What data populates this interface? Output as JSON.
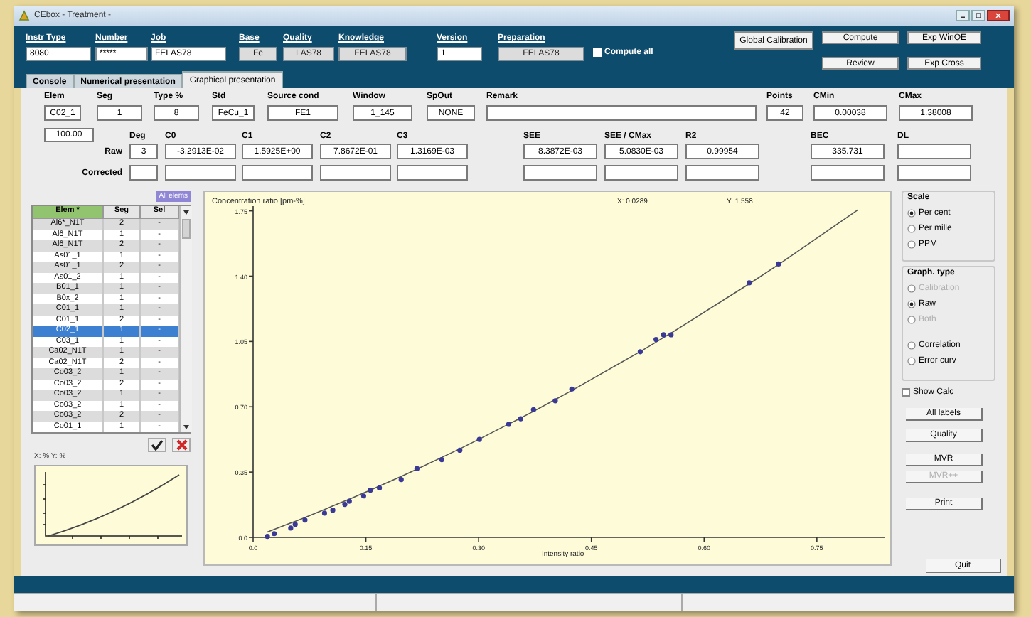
{
  "window": {
    "title": "CEbox - Treatment -"
  },
  "header": {
    "fields": [
      {
        "label": "Instr Type",
        "value": "8080",
        "disabled": false
      },
      {
        "label": "Number",
        "value": "*****",
        "disabled": false
      },
      {
        "label": "Job",
        "value": "FELAS78",
        "disabled": false
      },
      {
        "label": "Base",
        "value": "Fe",
        "disabled": true
      },
      {
        "label": "Quality",
        "value": "LAS78",
        "disabled": true
      },
      {
        "label": "Knowledge",
        "value": "FELAS78",
        "disabled": true
      },
      {
        "label": "Version",
        "value": "1",
        "disabled": false
      },
      {
        "label": "Preparation",
        "value": "FELAS78",
        "disabled": true
      }
    ],
    "compute_all": {
      "label": "Compute all",
      "checked": false
    },
    "buttons": [
      "Global Calibration",
      "Compute",
      "Exp WinOE",
      "Review",
      "Exp Cross"
    ]
  },
  "tabs": [
    {
      "label": "Console",
      "selected": false
    },
    {
      "label": "Numerical presentation",
      "selected": false
    },
    {
      "label": "Graphical presentation",
      "selected": true
    }
  ],
  "element_form": {
    "fields": [
      {
        "label": "Elem",
        "value": "C02_1"
      },
      {
        "label": "Seg",
        "value": "1"
      },
      {
        "label": "Type %",
        "value": "8"
      },
      {
        "label": "Std",
        "value": "FeCu_1"
      },
      {
        "label": "Source cond",
        "value": "FE1"
      },
      {
        "label": "Window",
        "value": "1_145"
      },
      {
        "label": "SpOut",
        "value": "NONE"
      },
      {
        "label": "Remark"
      },
      {
        "label": "Points",
        "value": "42"
      },
      {
        "label": "CMin",
        "value": "0.00038"
      },
      {
        "label": "CMax",
        "value": "1.38008"
      }
    ],
    "field_under_elem": "100.00"
  },
  "calibration": {
    "row_labels": [
      "Raw",
      "Corrected"
    ],
    "columns": [
      {
        "label": "Deg",
        "raw": "3"
      },
      {
        "label": "C0",
        "raw": "-3.2913E-02"
      },
      {
        "label": "C1",
        "raw": "1.5925E+00"
      },
      {
        "label": "C2",
        "raw": "7.8672E-01"
      },
      {
        "label": "C3",
        "raw": "1.3169E-03"
      },
      {
        "label": "SEE",
        "raw": "8.3872E-03"
      },
      {
        "label": "SEE / CMax",
        "raw": "5.0830E-03"
      },
      {
        "label": "R2",
        "raw": "0.99954"
      },
      {
        "label": "BEC",
        "raw": "335.731"
      },
      {
        "label": "DL"
      }
    ]
  },
  "element_list": {
    "all_button": "All elems",
    "columns": [
      "Elem *",
      "Seg",
      "Sel"
    ],
    "rows": [
      {
        "elem": "Al6*_N1T",
        "seg": "2",
        "sel": "-",
        "selected": false
      },
      {
        "elem": "Al6_N1T",
        "seg": "1",
        "sel": "-",
        "selected": false
      },
      {
        "elem": "Al6_N1T",
        "seg": "2",
        "sel": "-",
        "selected": false
      },
      {
        "elem": "As01_1",
        "seg": "1",
        "sel": "-",
        "selected": false
      },
      {
        "elem": "As01_1",
        "seg": "2",
        "sel": "-",
        "selected": false
      },
      {
        "elem": "As01_2",
        "seg": "1",
        "sel": "-",
        "selected": false
      },
      {
        "elem": "B01_1",
        "seg": "1",
        "sel": "-",
        "selected": false
      },
      {
        "elem": "B0x_2",
        "seg": "1",
        "sel": "-",
        "selected": false
      },
      {
        "elem": "C01_1",
        "seg": "1",
        "sel": "-",
        "selected": false
      },
      {
        "elem": "C01_1",
        "seg": "2",
        "sel": "-",
        "selected": false
      },
      {
        "elem": "C02_1",
        "seg": "1",
        "sel": "-",
        "selected": true
      },
      {
        "elem": "C03_1",
        "seg": "1",
        "sel": "-",
        "selected": false
      },
      {
        "elem": "Ca02_N1T",
        "seg": "1",
        "sel": "-",
        "selected": false
      },
      {
        "elem": "Ca02_N1T",
        "seg": "2",
        "sel": "-",
        "selected": false
      },
      {
        "elem": "Co03_2",
        "seg": "1",
        "sel": "-",
        "selected": false
      },
      {
        "elem": "Co03_2",
        "seg": "2",
        "sel": "-",
        "selected": false
      },
      {
        "elem": "Co03_2",
        "seg": "1",
        "sel": "-",
        "selected": false
      },
      {
        "elem": "Co03_2",
        "seg": "1",
        "sel": "-",
        "selected": false
      },
      {
        "elem": "Co03_2",
        "seg": "2",
        "sel": "-",
        "selected": false
      },
      {
        "elem": "Co01_1",
        "seg": "1",
        "sel": "-",
        "selected": false
      }
    ]
  },
  "thumbnail": {
    "caption": "X: % Y: %"
  },
  "chart": {
    "cursor_x": "X: 0.0289",
    "cursor_y": "Y: 1.558",
    "chart_data": {
      "type": "scatter",
      "ylabel": "Concentration ratio [pm-%]",
      "xlabel": "Intensity ratio",
      "x": [
        0.019,
        0.028,
        0.05,
        0.056,
        0.069,
        0.095,
        0.106,
        0.122,
        0.128,
        0.147,
        0.156,
        0.168,
        0.197,
        0.218,
        0.251,
        0.275,
        0.301,
        0.34,
        0.356,
        0.373,
        0.402,
        0.424,
        0.515,
        0.536,
        0.546,
        0.556,
        0.66,
        0.699,
        0.805
      ],
      "series": [
        {
          "type": "scatter",
          "color": "#3a3a96",
          "values": [
            0.005,
            0.02,
            0.05,
            0.07,
            0.093,
            0.13,
            0.146,
            0.177,
            0.194,
            0.222,
            0.253,
            0.265,
            0.31,
            0.369,
            0.417,
            0.467,
            0.525,
            0.606,
            0.636,
            0.684,
            0.732,
            0.795,
            0.995,
            1.061,
            1.086,
            1.086,
            1.364,
            1.465,
            null
          ]
        },
        {
          "type": "line",
          "color": "#555555",
          "values": [
            0.029,
            0.043,
            0.077,
            0.086,
            0.107,
            0.149,
            0.168,
            0.195,
            0.205,
            0.238,
            0.254,
            0.275,
            0.327,
            0.366,
            0.429,
            0.475,
            0.527,
            0.607,
            0.64,
            0.676,
            0.739,
            0.787,
            0.996,
            1.046,
            1.071,
            1.095,
            1.359,
            1.462,
            1.757
          ]
        }
      ],
      "xlim": [
        0,
        0.84
      ],
      "ylim": [
        0,
        1.76
      ],
      "xticks": [
        {
          "value": 0,
          "label": "0.0"
        },
        {
          "value": 0.15,
          "label": "0.15"
        },
        {
          "value": 0.3,
          "label": "0.30"
        },
        {
          "value": 0.45,
          "label": "0.45"
        },
        {
          "value": 0.6,
          "label": "0.60"
        },
        {
          "value": 0.75,
          "label": "0.75"
        }
      ],
      "yticks": [
        {
          "value": 0,
          "label": "0.0"
        },
        {
          "value": 0.35,
          "label": "0.35"
        },
        {
          "value": 0.7,
          "label": "0.70"
        },
        {
          "value": 1.05,
          "label": "1.05"
        },
        {
          "value": 1.4,
          "label": "1.40"
        },
        {
          "value": 1.75,
          "label": "1.75"
        }
      ]
    }
  },
  "right_panel": {
    "scale": {
      "title": "Scale",
      "options": [
        {
          "label": "Per cent",
          "selected": true,
          "disabled": false
        },
        {
          "label": "Per mille",
          "selected": false,
          "disabled": false
        },
        {
          "label": "PPM",
          "selected": false,
          "disabled": false
        }
      ]
    },
    "graph_type": {
      "title": "Graph. type",
      "options": [
        {
          "label": "Calibration",
          "selected": false,
          "disabled": true
        },
        {
          "label": "Raw",
          "selected": true,
          "disabled": false
        },
        {
          "label": "Both",
          "selected": false,
          "disabled": true
        },
        {
          "label": "Correlation",
          "selected": false,
          "disabled": false
        },
        {
          "label": "Error curv",
          "selected": false,
          "disabled": false
        }
      ]
    },
    "show_calc": {
      "label": "Show Calc",
      "checked": false
    },
    "buttons": [
      {
        "label": "All labels",
        "disabled": false
      },
      {
        "label": "Quality",
        "disabled": false
      },
      {
        "label": "MVR",
        "disabled": false
      },
      {
        "label": "MVR++",
        "disabled": true
      },
      {
        "label": "Print",
        "disabled": false
      }
    ],
    "quit": "Quit"
  }
}
